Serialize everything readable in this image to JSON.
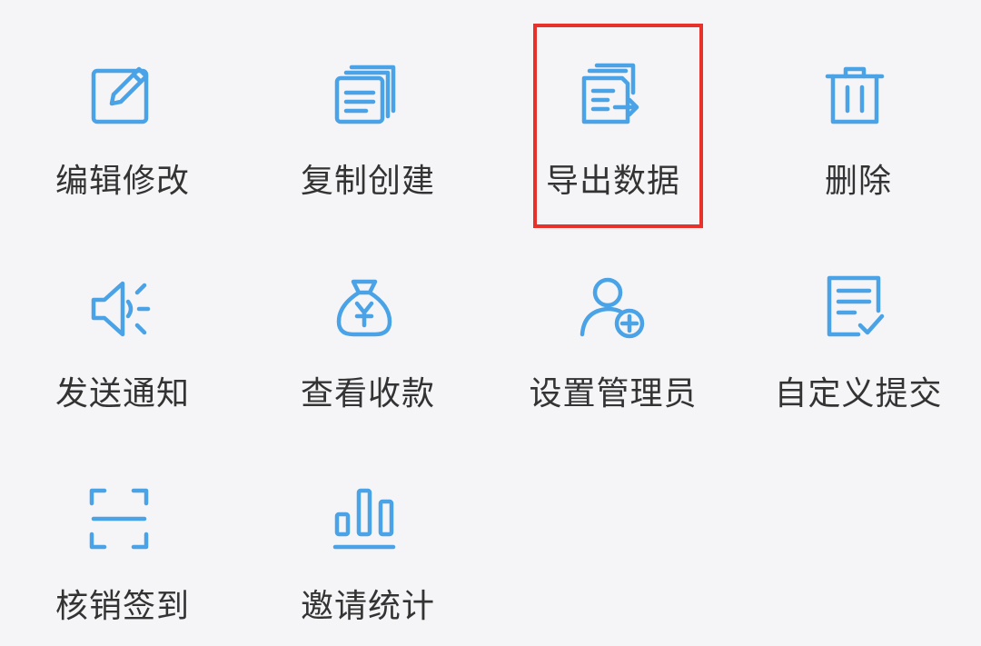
{
  "accent_color": "#4aa3e6",
  "highlight_color": "#e8312a",
  "menu": {
    "items": [
      {
        "label": "编辑修改",
        "icon": "edit-icon"
      },
      {
        "label": "复制创建",
        "icon": "copy-icon"
      },
      {
        "label": "导出数据",
        "icon": "export-icon"
      },
      {
        "label": "删除",
        "icon": "trash-icon"
      },
      {
        "label": "发送通知",
        "icon": "speaker-icon"
      },
      {
        "label": "查看收款",
        "icon": "money-bag-icon"
      },
      {
        "label": "设置管理员",
        "icon": "add-user-icon"
      },
      {
        "label": "自定义提交",
        "icon": "form-check-icon"
      },
      {
        "label": "核销签到",
        "icon": "scan-icon"
      },
      {
        "label": "邀请统计",
        "icon": "bar-chart-icon"
      }
    ]
  }
}
